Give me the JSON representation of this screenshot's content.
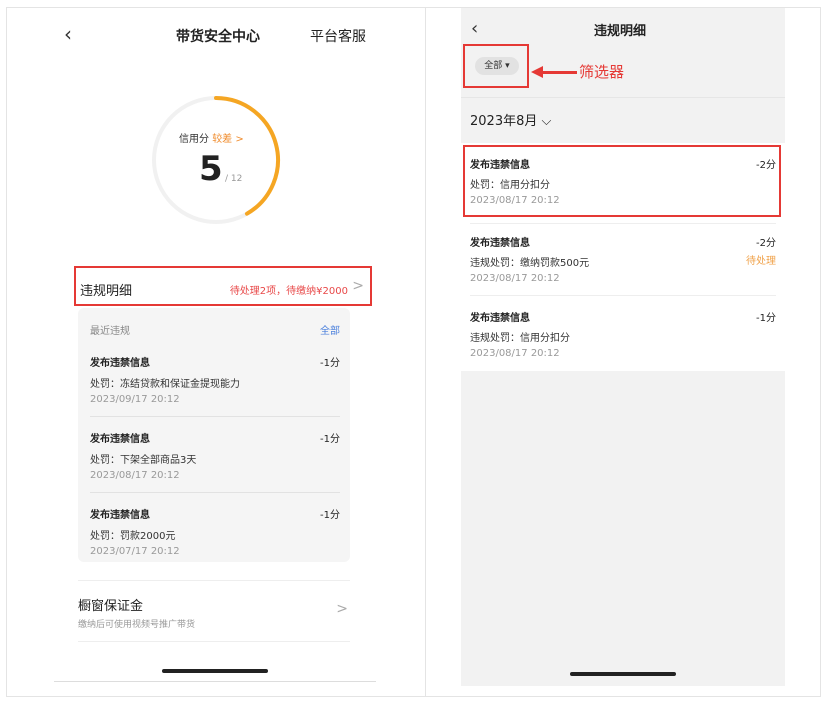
{
  "left": {
    "back_icon": "chevron-left-icon",
    "title": "带货安全中心",
    "service_link": "平台客服",
    "credit": {
      "label": "信用分",
      "level": "较差 >",
      "score": "5",
      "total": "/ 12",
      "score_fraction": 0.4167,
      "gauge_color": "#f5a623"
    },
    "violations": {
      "title": "违规明细",
      "status": "待处理2项，待缴纳¥2000",
      "chevron": ">"
    },
    "recent": {
      "heading": "最近违规",
      "all_link": "全部",
      "items": [
        {
          "title": "发布违禁信息",
          "points": "-1分",
          "penalty": "处罚：冻结贷款和保证金提现能力",
          "date": "2023/09/17 20:12"
        },
        {
          "title": "发布违禁信息",
          "points": "-1分",
          "penalty": "处罚：下架全部商品3天",
          "date": "2023/08/17 20:12"
        },
        {
          "title": "发布违禁信息",
          "points": "-1分",
          "penalty": "处罚：罚款2000元",
          "date": "2023/07/17 20:12"
        }
      ]
    },
    "deposit": {
      "title": "橱窗保证金",
      "subtitle": "缴纳后可使用视频号推广带货",
      "chevron": ">"
    }
  },
  "right": {
    "back_icon": "chevron-left-icon",
    "title": "违规明细",
    "filter": {
      "label": "全部 ▾",
      "annotation": "筛选器"
    },
    "month": "2023年8月 ⌵",
    "entries": [
      {
        "title": "发布违禁信息",
        "points": "-2分",
        "penalty": "处罚：信用分扣分",
        "date": "2023/08/17 20:12",
        "badge": ""
      },
      {
        "title": "发布违禁信息",
        "points": "-2分",
        "penalty": "违规处罚：缴纳罚款500元",
        "date": "2023/08/17 20:12",
        "badge": "待处理"
      },
      {
        "title": "发布违禁信息",
        "points": "-1分",
        "penalty": "违规处罚：信用分扣分",
        "date": "2023/08/17 20:12",
        "badge": ""
      }
    ]
  },
  "colors": {
    "accent_red": "#e53935",
    "warning_orange": "#f0a24a",
    "link_blue": "#4a7fdc"
  }
}
